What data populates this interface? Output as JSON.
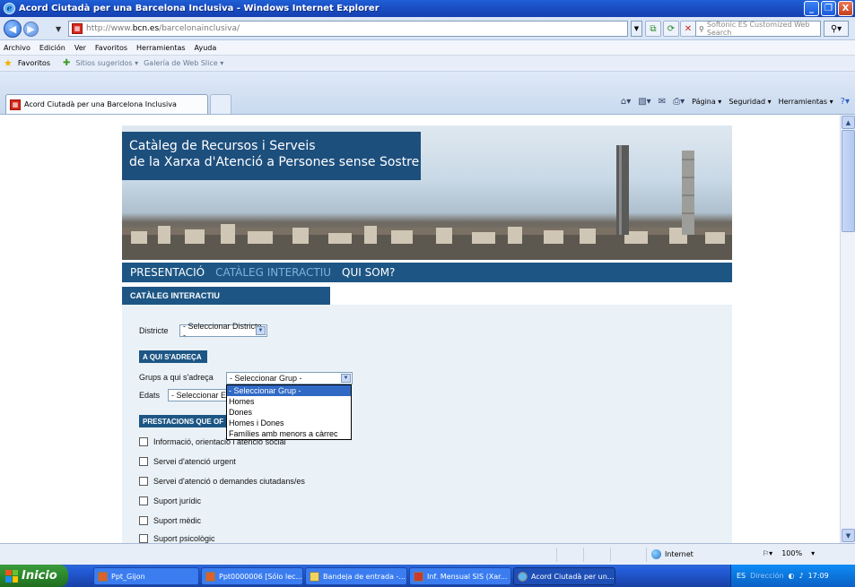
{
  "window": {
    "title": "Acord Ciutadà per una Barcelona Inclusiva - Windows Internet Explorer",
    "buttons": [
      "_",
      "❐",
      "X"
    ]
  },
  "address_bar": {
    "url_prefix": "http://www.",
    "url_host": "bcn.es",
    "url_path": "/barcelonainclusiva/",
    "search_placeholder": "Softonic ES Customized Web Search"
  },
  "menu": [
    "Archivo",
    "Edición",
    "Ver",
    "Favoritos",
    "Herramientas",
    "Ayuda"
  ],
  "favorites_bar": {
    "favorites_label": "Favoritos",
    "suggested_sites": "Sitios sugeridos ▾",
    "web_slice": "Galería de Web Slice ▾"
  },
  "tab": {
    "label": "Acord Ciutadà per una Barcelona Inclusiva"
  },
  "command_bar": [
    "Página ▾",
    "Seguridad ▾",
    "Herramientas ▾"
  ],
  "page": {
    "banner_title_line1": "Catàleg de Recursos i Serveis",
    "banner_title_line2": "de la Xarxa d'Atenció a Persones sense Sostre",
    "nav": [
      "PRESENTACIÓ",
      "CATÀLEG INTERACTIU",
      "QUI SOM?"
    ],
    "section_title": "CATÀLEG INTERACTIU",
    "districte_label": "Districte",
    "districte_value": "- Seleccionar Districte -",
    "a_qui_heading": "A QUI S'ADREÇA",
    "grups_label": "Grups a qui s'adreça",
    "grups_value": "- Seleccionar Grup -",
    "edats_label": "Edats",
    "edats_value": "- Seleccionar E",
    "prestacions_heading": "PRESTACIONS QUE OF",
    "grups_options": [
      "- Seleccionar Grup -",
      "Homes",
      "Dones",
      "Homes i Dones",
      "Famílies amb menors a càrrec"
    ],
    "checkboxes": [
      "Informació, orientació i atenció social",
      "Servei d'atenció urgent",
      "Servei d'atenció o demandes ciutadans/es",
      "Suport jurídic",
      "Suport mèdic",
      "Suport psicològic"
    ]
  },
  "status_bar": {
    "zone": "Internet",
    "zoom": "100%"
  },
  "taskbar": {
    "start_label": "Inicio",
    "tasks": [
      "Ppt_Gijon",
      "Ppt0000006 [Sólo lec...",
      "Bandeja de entrada -...",
      "Inf. Mensual SIS (Xar...",
      "Acord Ciutadà per un..."
    ],
    "tray_lang": "ES",
    "tray_direction": "Dirección",
    "clock": "17:09"
  }
}
